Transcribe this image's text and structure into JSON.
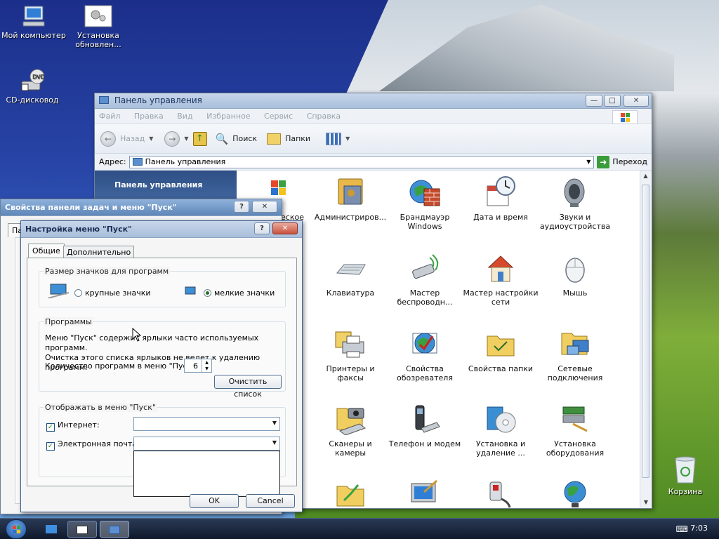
{
  "desktop": {
    "icons": [
      {
        "label": "Мой компьютер",
        "icon": "computer-icon"
      },
      {
        "label": "Установка обновлен...",
        "icon": "update-gear-icon"
      },
      {
        "label": "CD-дисковод",
        "icon": "dvd-drive-icon"
      },
      {
        "label": "Корзина",
        "icon": "recycle-bin-icon"
      }
    ]
  },
  "cp_window": {
    "title": "Панель управления",
    "menu": [
      "Файл",
      "Правка",
      "Вид",
      "Избранное",
      "Сервис",
      "Справка"
    ],
    "back_label": "Назад",
    "search_label": "Поиск",
    "folders_label": "Папки",
    "address_label": "Адрес:",
    "address_value": "Панель управления",
    "go_label": "Переход",
    "sidebar_title": "Панель управления",
    "partial_item": "ческое",
    "items": [
      {
        "label": "Администриров...",
        "icon": "admin-tools-icon"
      },
      {
        "label": "Брандмауэр Windows",
        "icon": "firewall-icon"
      },
      {
        "label": "Дата и время",
        "icon": "date-time-icon"
      },
      {
        "label": "Звуки и аудиоустройства",
        "icon": "speaker-icon"
      },
      {
        "label": "Клавиатура",
        "icon": "keyboard-icon"
      },
      {
        "label": "Мастер беспроводн...",
        "icon": "wireless-icon"
      },
      {
        "label": "Мастер настройки сети",
        "icon": "network-setup-icon"
      },
      {
        "label": "Мышь",
        "icon": "mouse-icon"
      },
      {
        "label": "Принтеры и факсы",
        "icon": "printer-icon"
      },
      {
        "label": "Свойства обозревателя",
        "icon": "internet-options-icon"
      },
      {
        "label": "Свойства папки",
        "icon": "folder-options-icon"
      },
      {
        "label": "Сетевые подключения",
        "icon": "network-connections-icon"
      },
      {
        "label": "Сканеры и камеры",
        "icon": "scanner-icon"
      },
      {
        "label": "Телефон и модем",
        "icon": "phone-modem-icon"
      },
      {
        "label": "Установка и удаление ...",
        "icon": "add-remove-icon"
      },
      {
        "label": "Установка оборудования",
        "icon": "hardware-icon"
      }
    ]
  },
  "taskbar_props": {
    "title": "Свойства панели задач и меню \"Пуск\"",
    "tab_partial": "Па"
  },
  "start_menu_dialog": {
    "title": "Настройка меню \"Пуск\"",
    "tabs": [
      "Общие",
      "Дополнительно"
    ],
    "icon_size_group": "Размер значков для программ",
    "large_icons": "крупные значки",
    "small_icons": "мелкие значки",
    "programs_group": "Программы",
    "programs_text_1": "Меню \"Пуск\" содержит ярлыки часто используемых программ.",
    "programs_text_2": "Очистка этого списка ярлыков не ведет к удалению программ.",
    "count_label": "Количество программ в меню \"Пуск\":",
    "count_value": "6",
    "clear_button": "Очистить список",
    "show_group": "Отображать в меню \"Пуск\"",
    "internet_label": "Интернет:",
    "email_label": "Электронная почта:",
    "ok": "OK",
    "cancel": "Cancel"
  },
  "taskbar": {
    "time": "7:03"
  }
}
